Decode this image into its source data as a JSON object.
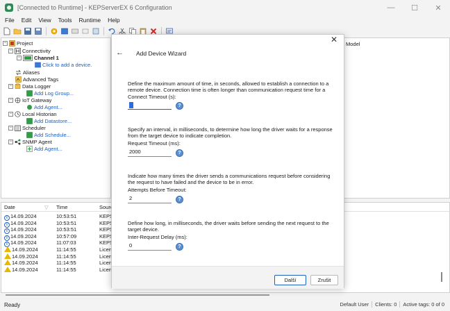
{
  "window": {
    "title": "[Connected to Runtime] - KEPServerEX 6 Configuration",
    "minimize_glyph": "—",
    "maximize_glyph": "☐",
    "close_glyph": "✕"
  },
  "menu": [
    "File",
    "Edit",
    "View",
    "Tools",
    "Runtime",
    "Help"
  ],
  "tree": {
    "project": "Project",
    "connectivity": "Connectivity",
    "channel": "Channel 1",
    "add_device": "Click to add a device.",
    "aliases": "Aliases",
    "advanced_tags": "Advanced Tags",
    "data_logger": "Data Logger",
    "add_log_group": "Add Log Group...",
    "iot_gateway": "IoT Gateway",
    "add_agent_iot": "Add Agent...",
    "local_historian": "Local Historian",
    "add_datastore": "Add Datastore...",
    "scheduler": "Scheduler",
    "add_schedule": "Add Schedule...",
    "snmp_agent": "SNMP Agent",
    "add_agent_snmp": "Add Agent..."
  },
  "right_panel": {
    "header": "Model"
  },
  "log": {
    "headers": {
      "date": "Date",
      "time": "Time",
      "source": "Sourc"
    },
    "rows": [
      {
        "type": "info",
        "date": "14.09.2024",
        "time": "10:53:51",
        "source": "KEPS"
      },
      {
        "type": "info",
        "date": "14.09.2024",
        "time": "10:53:51",
        "source": "KEPS"
      },
      {
        "type": "info",
        "date": "14.09.2024",
        "time": "10:53:51",
        "source": "KEPS"
      },
      {
        "type": "info",
        "date": "14.09.2024",
        "time": "10:57:09",
        "source": "KEPS"
      },
      {
        "type": "info",
        "date": "14.09.2024",
        "time": "11:07:03",
        "source": "KEPS"
      },
      {
        "type": "warning",
        "date": "14.09.2024",
        "time": "11:14:55",
        "source": "Licen"
      },
      {
        "type": "warning",
        "date": "14.09.2024",
        "time": "11:14:55",
        "source": "Licen"
      },
      {
        "type": "warning",
        "date": "14.09.2024",
        "time": "11:14:55",
        "source": "Licen"
      },
      {
        "type": "warning",
        "date": "14.09.2024",
        "time": "11:14:55",
        "source": "Licen"
      }
    ],
    "trailing_mark": "l,"
  },
  "status": {
    "ready": "Ready",
    "user": "Default User",
    "clients": "Clients: 0",
    "active_tags": "Active tags: 0 of 0"
  },
  "dialog": {
    "title": "Add Device Wizard",
    "close_glyph": "✕",
    "back_glyph": "←",
    "help_glyph": "?",
    "sections": [
      {
        "description": "Define the maximum amount of time, in seconds, allowed to establish a connection to a remote device. Connection time is often longer than communication request time for a",
        "label": "Connect Timeout (s):",
        "value": "3"
      },
      {
        "description": "Specify an interval, in milliseconds, to determine how long the driver waits for a response from the target device to indicate completion.",
        "label": "Request Timeout (ms):",
        "value": "2000"
      },
      {
        "description": "Indicate how many times the driver sends a communications request before considering the request to have failed and the device to be in error.",
        "label": "Attempts Before Timeout:",
        "value": "2"
      },
      {
        "description": "Define how long, in milliseconds, the driver waits before sending the next request to the target device.",
        "label": "Inter-Request Delay (ms):",
        "value": "0"
      }
    ],
    "next_label": "Další",
    "cancel_label": "Zrušit"
  }
}
